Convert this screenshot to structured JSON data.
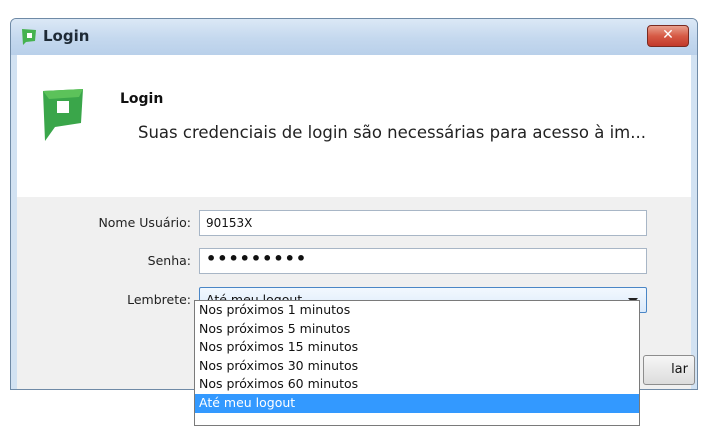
{
  "window": {
    "title": "Login",
    "close_glyph": "✕"
  },
  "banner": {
    "title": "Login",
    "subtitle": "Suas credenciais de login são necessárias para acesso à im..."
  },
  "form": {
    "username_label": "Nome Usuário:",
    "username_value": "90153X",
    "password_label": "Senha:",
    "password_value": "•••••••••",
    "reminder_label": "Lembrete:",
    "reminder_value": "Até meu logout"
  },
  "dropdown": {
    "options": [
      "Nos próximos 1 minutos",
      "Nos próximos 5 minutos",
      "Nos próximos 15 minutos",
      "Nos próximos 30 minutos",
      "Nos próximos 60 minutos",
      "Até meu logout"
    ],
    "selected": "Até meu logout"
  },
  "buttons": {
    "cancel_partial": "lar"
  },
  "icons": {
    "app": "app-logo-icon",
    "close": "close-icon",
    "dropdown": "chevron-down-icon"
  },
  "colors": {
    "accent": "#3399ff",
    "logo_green": "#3aa64a",
    "close_red": "#d65a45"
  }
}
